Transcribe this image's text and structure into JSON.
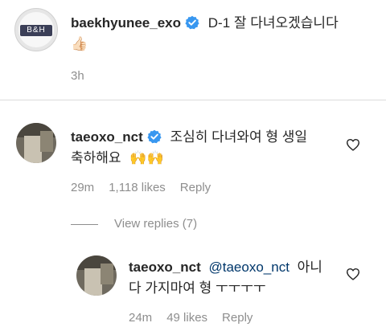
{
  "post": {
    "username": "baekhyunee_exo",
    "caption": "D-1 잘 다녀오겠습니다",
    "caption_emoji": "👍🏻",
    "time": "3h",
    "avatar_text": "B&H"
  },
  "comments": [
    {
      "username": "taeoxo_nct",
      "text_line1": "조심히 다녀와여 형 생일",
      "text_line2": "축하해요",
      "emoji": "🙌🙌",
      "time": "29m",
      "likes": "1,118 likes",
      "reply": "Reply"
    }
  ],
  "view_replies": "View replies (7)",
  "reply": {
    "username": "taeoxo_nct",
    "mention": "@taeoxo_nct",
    "text_line1_suffix": "아니",
    "text_line2": "다 가지마여 형 ㅜㅜㅜㅜ",
    "time": "24m",
    "likes": "49 likes",
    "reply": "Reply"
  },
  "colors": {
    "text": "#262626",
    "meta": "#8e8e8e",
    "verified": "#3897f0",
    "mention": "#00376b",
    "divider": "#dbdbdb"
  },
  "icons": {
    "verified": "verified-badge-icon",
    "like": "heart-outline-icon"
  }
}
